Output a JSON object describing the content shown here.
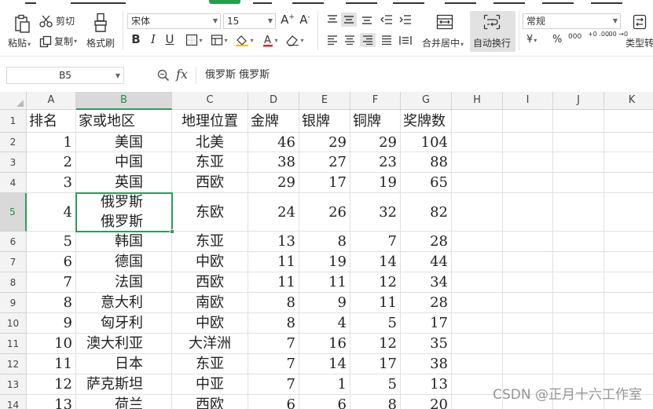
{
  "ribbon": {
    "paste": "粘贴",
    "cut": "剪切",
    "copy": "复制",
    "format_painter": "格式刷",
    "font_name": "宋体",
    "font_size": "15",
    "grow_font": "A⁺",
    "shrink_font": "A⁻",
    "bold": "B",
    "italic": "I",
    "underline": "U",
    "merge_center": "合并居中",
    "wrap_text": "自动换行",
    "number_format": "常规",
    "currency": "¥",
    "percent": "%",
    "thousands": "000",
    "inc_decimal": "+0 .00",
    "dec_decimal": ".00 →0",
    "type_convert": "类型转"
  },
  "formula_bar": {
    "name_box": "B5",
    "fx": "fx",
    "content": "俄罗斯 俄罗斯"
  },
  "grid": {
    "columns": [
      "A",
      "B",
      "C",
      "D",
      "E",
      "F",
      "G",
      "H",
      "I",
      "J",
      "K"
    ],
    "selected_column": "B",
    "selected_row": "5",
    "rows": [
      {
        "num": "1",
        "cells": [
          "排名",
          "家或地区",
          "地理位置",
          "金牌",
          "银牌",
          "铜牌",
          "奖牌数"
        ]
      },
      {
        "num": "2",
        "cells": [
          "1",
          "美国",
          "北美",
          "46",
          "29",
          "29",
          "104"
        ]
      },
      {
        "num": "3",
        "cells": [
          "2",
          "中国",
          "东亚",
          "38",
          "27",
          "23",
          "88"
        ]
      },
      {
        "num": "4",
        "cells": [
          "3",
          "英国",
          "西欧",
          "29",
          "17",
          "19",
          "65"
        ]
      },
      {
        "num": "5",
        "cells": [
          "4",
          "俄罗斯\n俄罗斯",
          "东欧",
          "24",
          "26",
          "32",
          "82"
        ]
      },
      {
        "num": "6",
        "cells": [
          "5",
          "韩国",
          "东亚",
          "13",
          "8",
          "7",
          "28"
        ]
      },
      {
        "num": "7",
        "cells": [
          "6",
          "德国",
          "中欧",
          "11",
          "19",
          "14",
          "44"
        ]
      },
      {
        "num": "8",
        "cells": [
          "7",
          "法国",
          "西欧",
          "11",
          "11",
          "12",
          "34"
        ]
      },
      {
        "num": "9",
        "cells": [
          "8",
          "意大利",
          "南欧",
          "8",
          "9",
          "11",
          "28"
        ]
      },
      {
        "num": "10",
        "cells": [
          "9",
          "匈牙利",
          "中欧",
          "8",
          "4",
          "5",
          "17"
        ]
      },
      {
        "num": "11",
        "cells": [
          "10",
          "澳大利亚",
          "大洋洲",
          "7",
          "16",
          "12",
          "35"
        ]
      },
      {
        "num": "12",
        "cells": [
          "11",
          "日本",
          "东亚",
          "7",
          "14",
          "17",
          "38"
        ]
      },
      {
        "num": "13",
        "cells": [
          "12",
          "萨克斯坦",
          "中亚",
          "7",
          "1",
          "5",
          "13"
        ]
      },
      {
        "num": "14",
        "cells": [
          "13",
          "荷兰",
          "西欧",
          "6",
          "6",
          "8",
          "20"
        ]
      }
    ]
  },
  "watermark": "CSDN @正月十六工作室",
  "colors": {
    "accent": "#2f9a5c",
    "header_bg": "#f3f3f3",
    "header_selected_bg": "#d9d9d9"
  }
}
